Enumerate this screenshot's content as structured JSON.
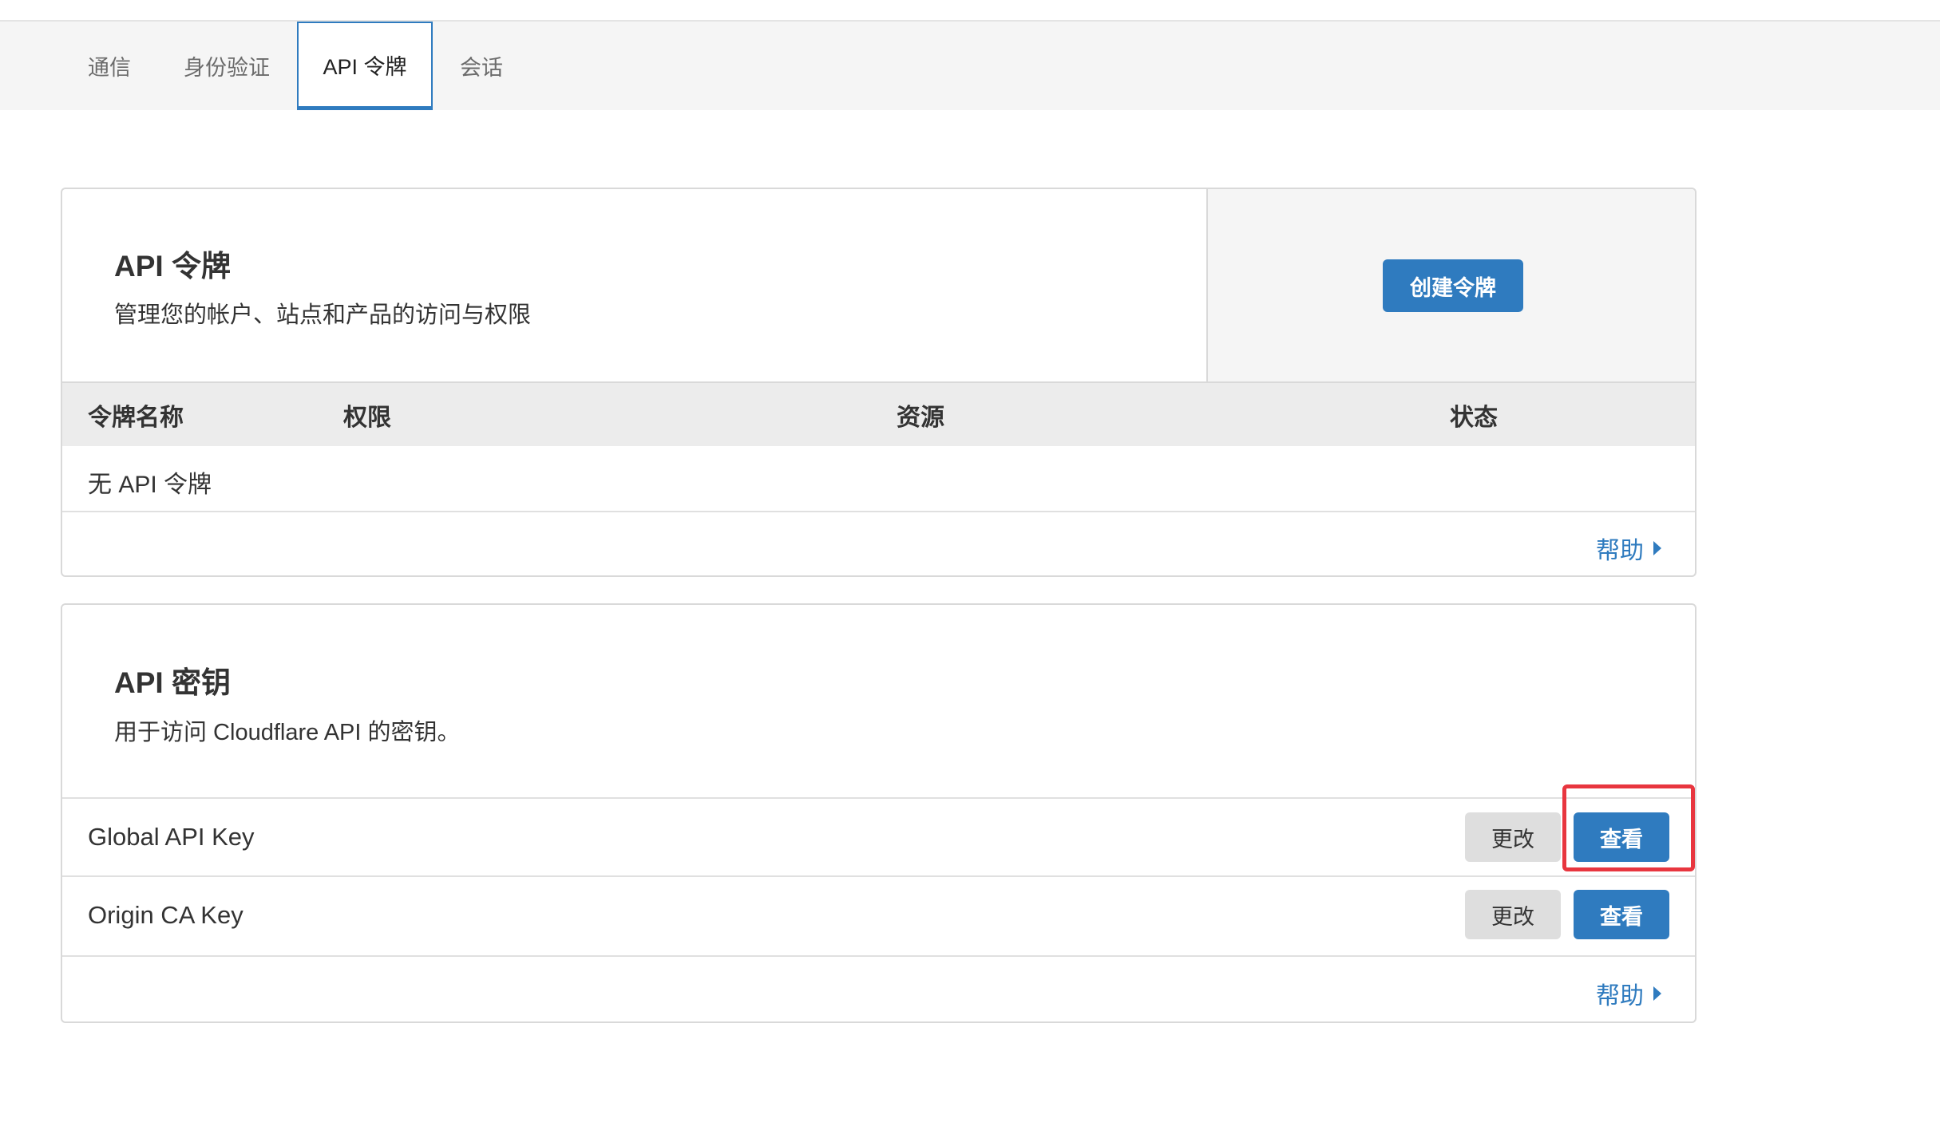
{
  "tabs": [
    {
      "label": "通信",
      "active": false
    },
    {
      "label": "身份验证",
      "active": false
    },
    {
      "label": "API 令牌",
      "active": true
    },
    {
      "label": "会话",
      "active": false
    }
  ],
  "api_tokens": {
    "title": "API 令牌",
    "description": "管理您的帐户、站点和产品的访问与权限",
    "create_button": "创建令牌",
    "columns": [
      "令牌名称",
      "权限",
      "资源",
      "状态"
    ],
    "empty_text": "无 API 令牌",
    "help_link": "帮助"
  },
  "api_keys": {
    "title": "API 密钥",
    "description": "用于访问 Cloudflare API 的密钥。",
    "keys": [
      {
        "name": "Global API Key",
        "change_label": "更改",
        "view_label": "查看"
      },
      {
        "name": "Origin CA Key",
        "change_label": "更改",
        "view_label": "查看"
      }
    ],
    "help_link": "帮助"
  },
  "colors": {
    "accent": "#2f7bbf",
    "highlight": "#e8363f",
    "tabbar_bg": "#f5f5f5"
  }
}
